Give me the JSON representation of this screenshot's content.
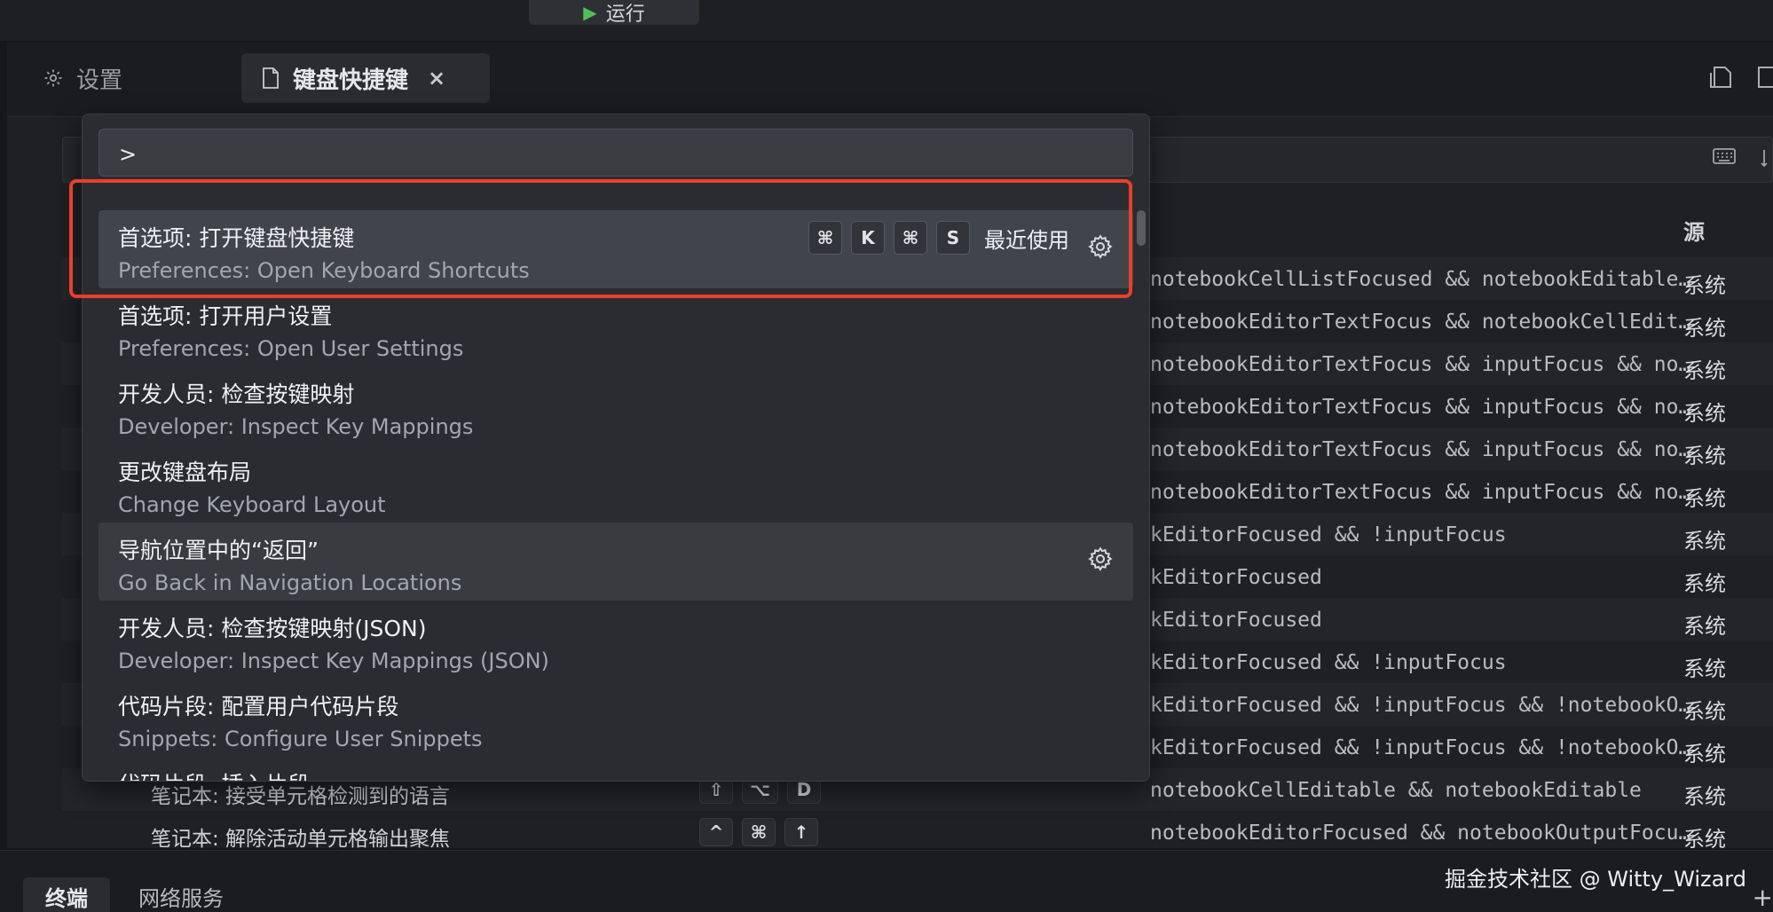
{
  "topbar": {
    "run_label": "运行"
  },
  "tabs": [
    {
      "label": "设置",
      "icon": "gear-icon"
    },
    {
      "label": "键盘快捷键",
      "icon": "file-icon",
      "close": "×"
    }
  ],
  "keybindings": {
    "header_source": "源",
    "rows": [
      {
        "command": "",
        "keys": [],
        "when": "notebookCellListFocused && notebookEditable && notebookEditorFocused",
        "source": "系统"
      },
      {
        "command": "",
        "keys": [],
        "when": "notebookEditorTextFocus && notebookCellEditable && notebookEditorFocused",
        "source": "系统"
      },
      {
        "command": "",
        "keys": [],
        "when": "notebookEditorTextFocus && inputFocus && notebookEditorFocused",
        "source": "系统"
      },
      {
        "command": "",
        "keys": [],
        "when": "notebookEditorTextFocus && inputFocus && notebookEditorFocused",
        "source": "系统"
      },
      {
        "command": "",
        "keys": [],
        "when": "notebookEditorTextFocus && inputFocus && notebookEditorFocused",
        "source": "系统"
      },
      {
        "command": "",
        "keys": [],
        "when": "notebookEditorTextFocus && inputFocus && notebookEditorFocused",
        "source": "系统"
      },
      {
        "command": "",
        "keys": [],
        "when": "kEditorFocused && !inputFocus",
        "source": "系统"
      },
      {
        "command": "",
        "keys": [],
        "when": "kEditorFocused",
        "source": "系统"
      },
      {
        "command": "",
        "keys": [],
        "when": "kEditorFocused",
        "source": "系统"
      },
      {
        "command": "",
        "keys": [],
        "when": "kEditorFocused && !inputFocus",
        "source": "系统"
      },
      {
        "command": "",
        "keys": [],
        "when": "kEditorFocused && !inputFocus && !notebookOutputFocused",
        "source": "系统"
      },
      {
        "command": "",
        "keys": [],
        "when": "kEditorFocused && !inputFocus && !notebookOutputFocused",
        "source": "系统"
      },
      {
        "command": "笔记本: 接受单元格检测到的语言",
        "keys": [
          "⇧",
          "⌥",
          "D"
        ],
        "when": "notebookCellEditable && notebookEditable",
        "source": "系统"
      },
      {
        "command": "笔记本: 解除活动单元格输出聚焦",
        "keys": [
          "^",
          "⌘",
          "↑"
        ],
        "when": "notebookEditorFocused && notebookOutputFocused",
        "source": "系统"
      }
    ]
  },
  "palette": {
    "input_value": ">",
    "items": [
      {
        "zh": "首选项: 打开键盘快捷键",
        "en": "Preferences: Open Keyboard Shortcuts",
        "keys": [
          "⌘",
          "K",
          "⌘",
          "S"
        ],
        "recent": "最近使用",
        "gear": true
      },
      {
        "zh": "首选项: 打开用户设置",
        "en": "Preferences: Open User Settings"
      },
      {
        "zh": "开发人员: 检查按键映射",
        "en": "Developer: Inspect Key Mappings"
      },
      {
        "zh": "更改键盘布局",
        "en": "Change Keyboard Layout"
      },
      {
        "zh": "导航位置中的“返回”",
        "en": "Go Back in Navigation Locations",
        "gear": true
      },
      {
        "zh": "开发人员: 检查按键映射(JSON)",
        "en": "Developer: Inspect Key Mappings (JSON)"
      },
      {
        "zh": "代码片段: 配置用户代码片段",
        "en": "Snippets: Configure User Snippets"
      },
      {
        "zh": "代码片段: 插入片段",
        "en": ""
      }
    ]
  },
  "bottom_panel": {
    "tabs": [
      "终端",
      "网络服务"
    ],
    "watermark": "掘金技术社区 @ Witty_Wizard",
    "add_label": "+"
  }
}
